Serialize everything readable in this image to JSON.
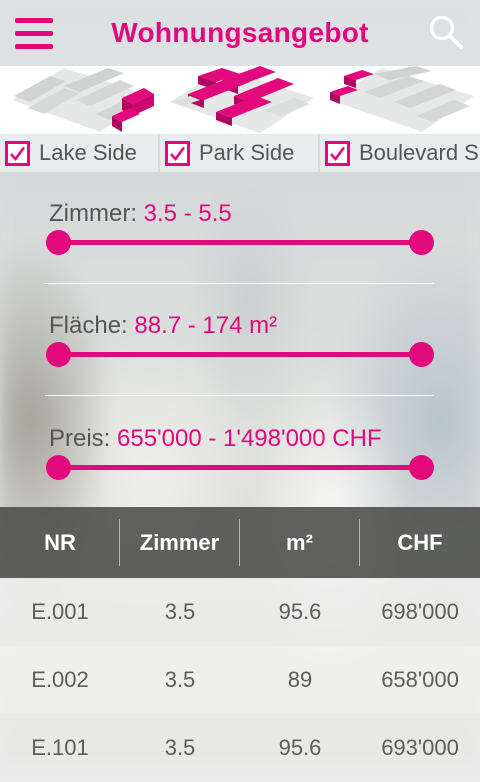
{
  "header": {
    "title": "Wohnungsangebot",
    "menu_icon": "hamburger-menu-icon",
    "search_icon": "search-icon"
  },
  "buildings": [
    {
      "name": "Lake Side",
      "checked": true
    },
    {
      "name": "Park Side",
      "checked": true
    },
    {
      "name": "Boulevard Süd",
      "checked": true
    }
  ],
  "filters": {
    "zimmer": {
      "label": "Zimmer:",
      "value": "3.5 - 5.5"
    },
    "flaeche": {
      "label": "Fläche:",
      "value": "88.7 - 174 m²"
    },
    "preis": {
      "label": "Preis:",
      "value": "655'000 - 1'498'000 CHF"
    }
  },
  "table": {
    "headers": {
      "nr": "NR",
      "zimmer": "Zimmer",
      "m2": "m²",
      "chf": "CHF"
    },
    "rows": [
      {
        "nr": "E.001",
        "zimmer": "3.5",
        "m2": "95.6",
        "chf": "698'000"
      },
      {
        "nr": "E.002",
        "zimmer": "3.5",
        "m2": "89",
        "chf": "658'000"
      },
      {
        "nr": "E.101",
        "zimmer": "3.5",
        "m2": "95.6",
        "chf": "693'000"
      }
    ]
  },
  "colors": {
    "accent": "#e2097c",
    "text": "#555555",
    "header_bar": "#4b4c4a"
  }
}
